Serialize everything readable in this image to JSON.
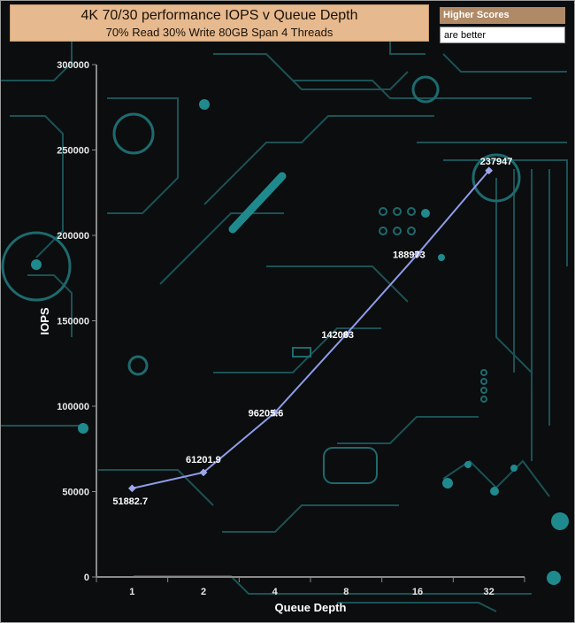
{
  "header": {
    "title": "4K 70/30 performance IOPS v Queue Depth",
    "subtitle": "70% Read 30% Write 80GB Span 4 Threads"
  },
  "legend": {
    "line1": "Higher Scores",
    "line2": "are better"
  },
  "colors": {
    "series_line": "#8f9be8",
    "marker": "#9aa6f0",
    "axis": "#8a8a8a",
    "title_bg": "#e7b98e",
    "circuit": "#1f6f73"
  },
  "chart_data": {
    "type": "line",
    "categories": [
      "1",
      "2",
      "4",
      "8",
      "16",
      "32"
    ],
    "values": [
      51882.7,
      61201.9,
      96205.6,
      142083,
      188973,
      237947
    ],
    "data_labels": [
      "51882.7",
      "61201.9",
      "96205.6",
      "142083",
      "188973",
      "237947"
    ],
    "xlabel": "Queue Depth",
    "ylabel": "IOPS",
    "ylim": [
      0,
      300000
    ],
    "yticks": [
      0,
      50000,
      100000,
      150000,
      200000,
      250000,
      300000
    ],
    "ytick_labels": [
      "0",
      "50000",
      "100000",
      "150000",
      "200000",
      "250000",
      "300000"
    ],
    "grid": false
  }
}
